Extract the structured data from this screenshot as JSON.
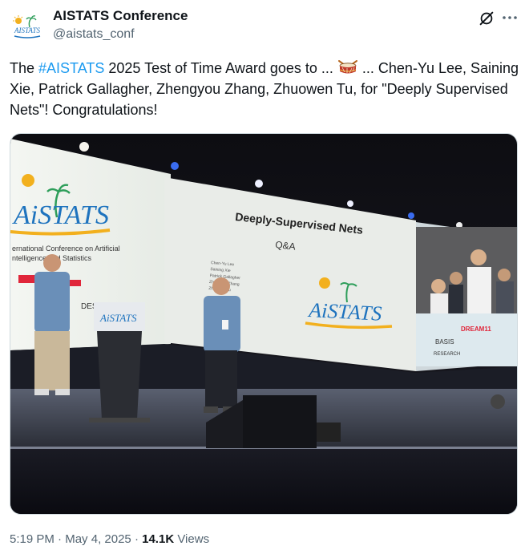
{
  "author": {
    "name": "AISTATS Conference",
    "handle": "@aistats_conf",
    "avatar_text": "AISTATS"
  },
  "post": {
    "text_before": "The ",
    "hashtag": "#AISTATS",
    "text_mid": " 2025 Test of Time Award goes to ... ",
    "text_after_emoji": " ... Chen-Yu Lee, Saining Xie, Patrick Gallagher, Zhengyou Zhang, Zhuowen Tu, for \"Deeply Supervised Nets\"! Congratulations!",
    "emoji": "drum-emoji"
  },
  "media": {
    "slide_title": "Deeply-Supervised Nets",
    "slide_subtitle": "Q&A",
    "slide_authors": [
      "Chen-Yu Lee",
      "Saining Xie",
      "Patrick Gallagher",
      "Zhengyou Zhang",
      "Zhuowen Tu"
    ],
    "left_banner_logo": "AiSTATS",
    "left_banner_text1": "ernational Conference on Artificial",
    "left_banner_text2": "ntelligence and Statistics",
    "left_banner_des": "DES",
    "slide_logo": "AiSTATS",
    "podium_logo": "AiSTATS",
    "right_sponsor1": "DREAM11",
    "right_sponsor2": "BASIS",
    "right_sponsor3": "RESEARCH"
  },
  "meta": {
    "time": "5:19 PM",
    "separator": " · ",
    "date": "May 4, 2025",
    "views_count": "14.1K",
    "views_label": " Views"
  },
  "colors": {
    "hashtag": "#1d9bf0",
    "secondary_text": "#536471",
    "primary_text": "#0f1419"
  }
}
